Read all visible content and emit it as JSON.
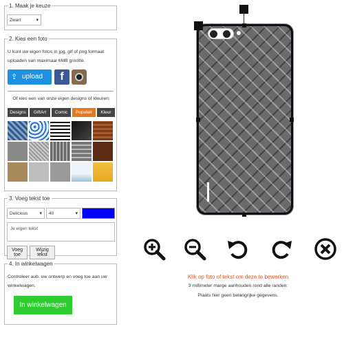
{
  "step1": {
    "legend": "1. Maak je keuze",
    "select_value": "Zwart"
  },
  "step2": {
    "legend": "2. Kies een foto",
    "description": "U kunt uw eigen fotos in jpg, gif of png formaat uploaden van maximaal 6MB grootte.",
    "upload_label": "upload",
    "designs_text": "Of kies een van onze eigen designs of kleuren:",
    "tabs": [
      "Designs",
      "GiftArt",
      "Comic",
      "Populair",
      "Kleur"
    ],
    "active_tab": "Populair"
  },
  "step3": {
    "legend": "3. Voeg tekst toe",
    "font_value": "Delicious",
    "size_value": "40",
    "color": "#0000ff",
    "text_placeholder": "Je eigen tekst",
    "add_button": "Voeg toe",
    "edit_button": "Wijzig tekst"
  },
  "step4": {
    "legend": "4. In winkelwagen",
    "description": "Controleer aub. uw ontwerp en voeg toe aan uw winkelwagen.",
    "cart_button": "In winkelwagen"
  },
  "tools": [
    "zoom-in-icon",
    "zoom-out-icon",
    "rotate-left-icon",
    "rotate-right-icon",
    "delete-icon"
  ],
  "instructions": {
    "line1": "Klik op foto of tekst om deze te bewerken",
    "line2": "3 millimeter marge aanhouden rond alle randen:",
    "line3": "Plaats hier geen belangrijke gegevens."
  },
  "colors": {
    "accent": "#e8781e",
    "cart": "#2ecc2e",
    "upload": "#1e90e0",
    "instructions_red": "#e8531e"
  }
}
